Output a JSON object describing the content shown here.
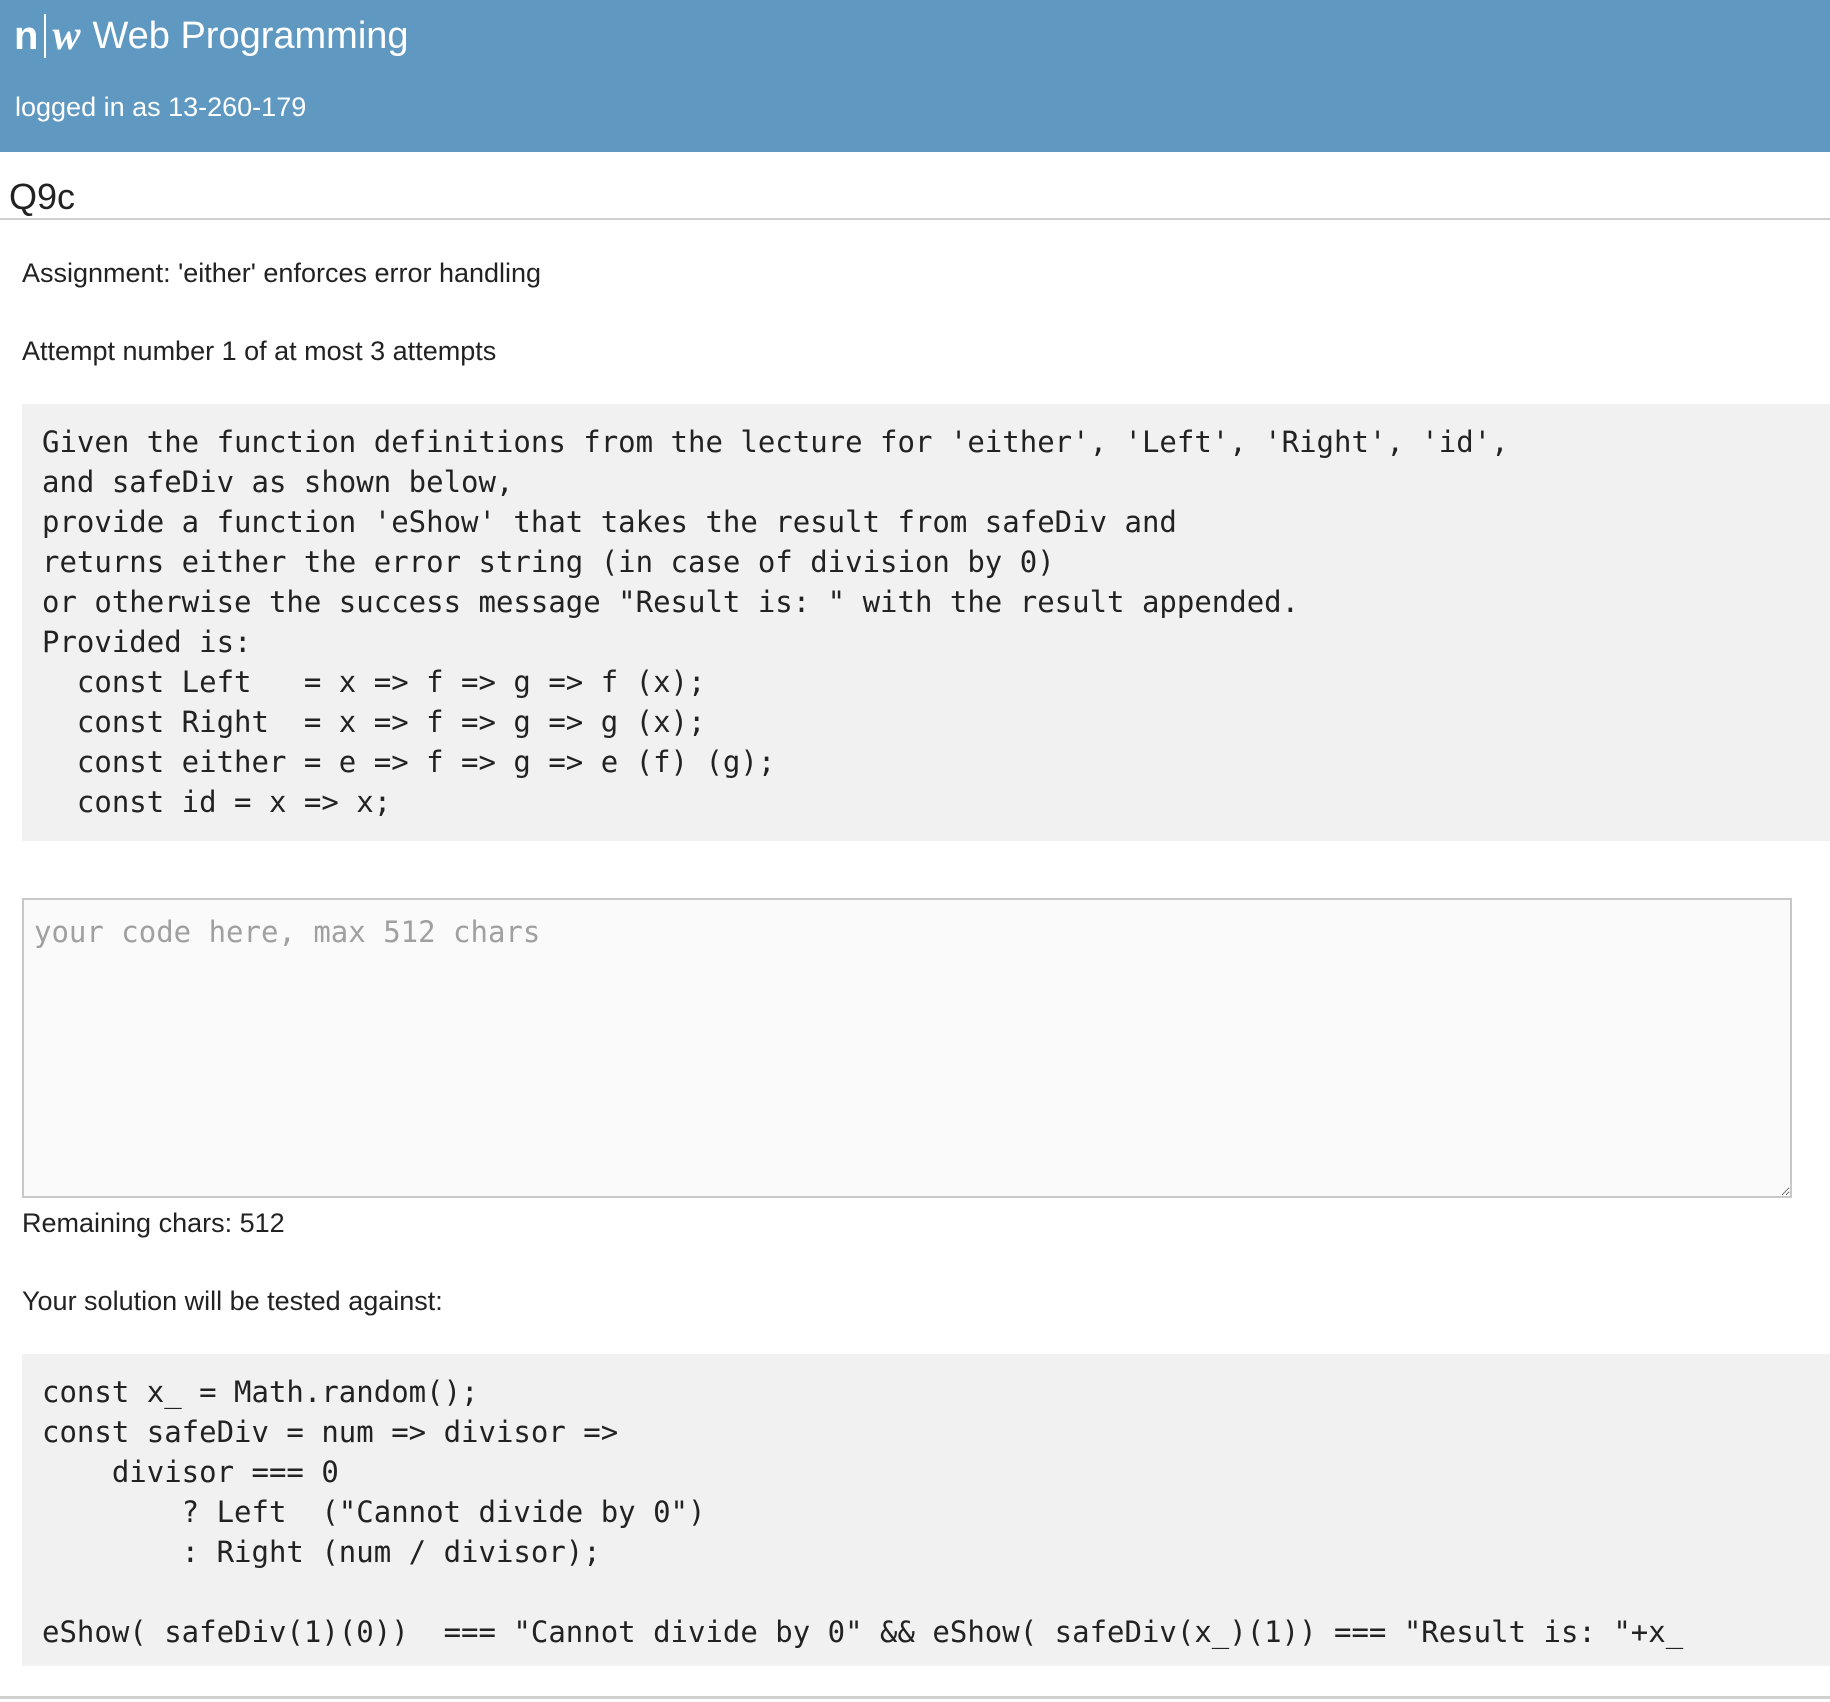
{
  "header": {
    "logo_n": "n",
    "logo_w": "w",
    "app_title": "Web Programming",
    "login_status": "logged in as 13-260-179",
    "background_color": "#5f98c1"
  },
  "page": {
    "title": "Q9c"
  },
  "assignment": {
    "text": "Assignment: 'either' enforces error handling"
  },
  "attempt": {
    "text": "Attempt number 1 of at most 3 attempts"
  },
  "task_description": "Given the function definitions from the lecture for 'either', 'Left', 'Right', 'id',\nand safeDiv as shown below,\nprovide a function 'eShow' that takes the result from safeDiv and\nreturns either the error string (in case of division by 0)\nor otherwise the success message \"Result is: \" with the result appended.\nProvided is:\n  const Left   = x => f => g => f (x);\n  const Right  = x => f => g => g (x);\n  const either = e => f => g => e (f) (g);\n  const id = x => x;",
  "editor": {
    "value": "",
    "placeholder": "your code here, max 512 chars"
  },
  "remaining": {
    "text": "Remaining chars: 512"
  },
  "tested_against": {
    "label": "Your solution will be tested against:",
    "code": "const x_ = Math.random();\nconst safeDiv = num => divisor =>\n    divisor === 0\n        ? Left  (\"Cannot divide by 0\")\n        : Right (num / divisor);\n\neShow( safeDiv(1)(0))  === \"Cannot divide by 0\" && eShow( safeDiv(x_)(1)) === \"Result is: \"+x_"
  }
}
